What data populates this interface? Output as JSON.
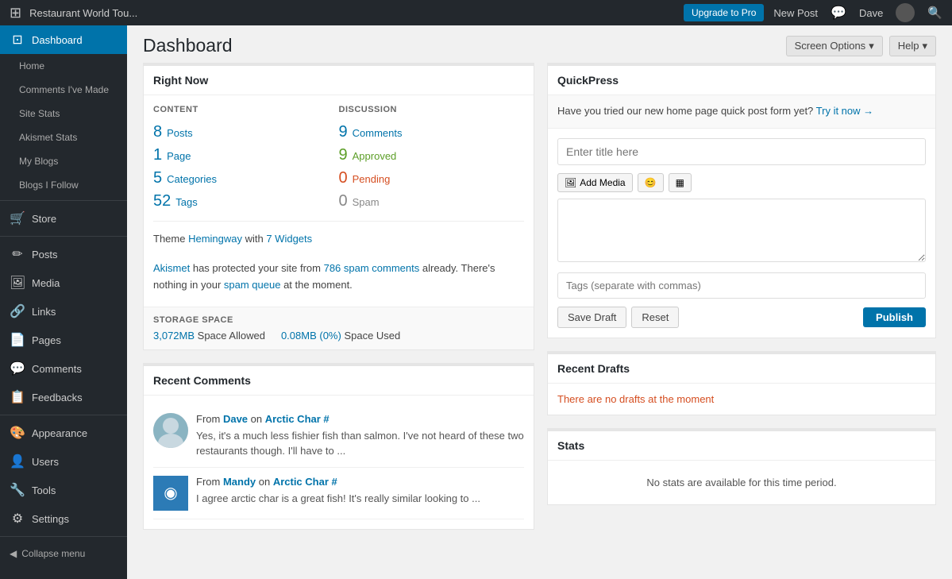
{
  "adminbar": {
    "logo": "W",
    "site_name": "Restaurant World Tou...",
    "upgrade_label": "Upgrade to Pro",
    "new_post_label": "New Post",
    "user_label": "Dave",
    "search_icon": "🔍"
  },
  "header": {
    "screen_options_label": "Screen Options",
    "help_label": "Help",
    "page_title": "Dashboard"
  },
  "sidebar": {
    "dashboard_label": "Dashboard",
    "home_label": "Home",
    "comments_made_label": "Comments I've Made",
    "site_stats_label": "Site Stats",
    "akismet_stats_label": "Akismet Stats",
    "my_blogs_label": "My Blogs",
    "blogs_i_follow_label": "Blogs I Follow",
    "store_label": "Store",
    "posts_label": "Posts",
    "media_label": "Media",
    "links_label": "Links",
    "pages_label": "Pages",
    "comments_label": "Comments",
    "feedbacks_label": "Feedbacks",
    "appearance_label": "Appearance",
    "users_label": "Users",
    "tools_label": "Tools",
    "settings_label": "Settings",
    "collapse_label": "Collapse menu"
  },
  "right_now": {
    "title": "Right Now",
    "content_label": "CONTENT",
    "discussion_label": "DISCUSSION",
    "posts_count": "8",
    "posts_label": "Posts",
    "pages_count": "1",
    "pages_label": "Page",
    "categories_count": "5",
    "categories_label": "Categories",
    "tags_count": "52",
    "tags_label": "Tags",
    "comments_count": "9",
    "comments_label": "Comments",
    "approved_count": "9",
    "approved_label": "Approved",
    "pending_count": "0",
    "pending_label": "Pending",
    "spam_count": "0",
    "spam_label": "Spam",
    "theme_text": "Theme ",
    "theme_name": "Hemingway",
    "theme_with": " with ",
    "widgets_link": "7 Widgets",
    "akismet_text_1": "Akismet",
    "akismet_text_2": " has protected your site from ",
    "spam_link_text": "786 spam comments",
    "akismet_text_3": " already. There's nothing in your ",
    "spam_queue_link": "spam queue",
    "akismet_text_4": " at the moment.",
    "storage_label": "STORAGE SPACE",
    "space_allowed": "3,072MB",
    "space_allowed_suffix": " Space Allowed",
    "space_used": "0.08MB (0%)",
    "space_used_suffix": " Space Used"
  },
  "recent_comments": {
    "title": "Recent Comments",
    "comment1": {
      "from_label": "From ",
      "author": "Dave",
      "on_label": " on ",
      "post": "Arctic Char #",
      "text": "Yes, it's a much less fishier fish than salmon. I've not heard of these two restaurants though. I'll have to ..."
    },
    "comment2": {
      "from_label": "From ",
      "author": "Mandy",
      "on_label": " on ",
      "post": "Arctic Char #",
      "text": "I agree arctic char is a great fish! It's really similar looking to ..."
    }
  },
  "quickpress": {
    "title": "QuickPress",
    "promo_text": "Have you tried our new home page quick post form yet? ",
    "promo_link": "Try it now →",
    "title_placeholder": "Enter title here",
    "add_media_label": "Add Media",
    "tags_placeholder": "Tags (separate with commas)",
    "save_draft_label": "Save Draft",
    "reset_label": "Reset",
    "publish_label": "Publish"
  },
  "recent_drafts": {
    "title": "Recent Drafts",
    "no_drafts_text": "There are no drafts at the moment"
  },
  "stats": {
    "title": "Stats",
    "no_stats_text": "No stats are available for this time period."
  }
}
